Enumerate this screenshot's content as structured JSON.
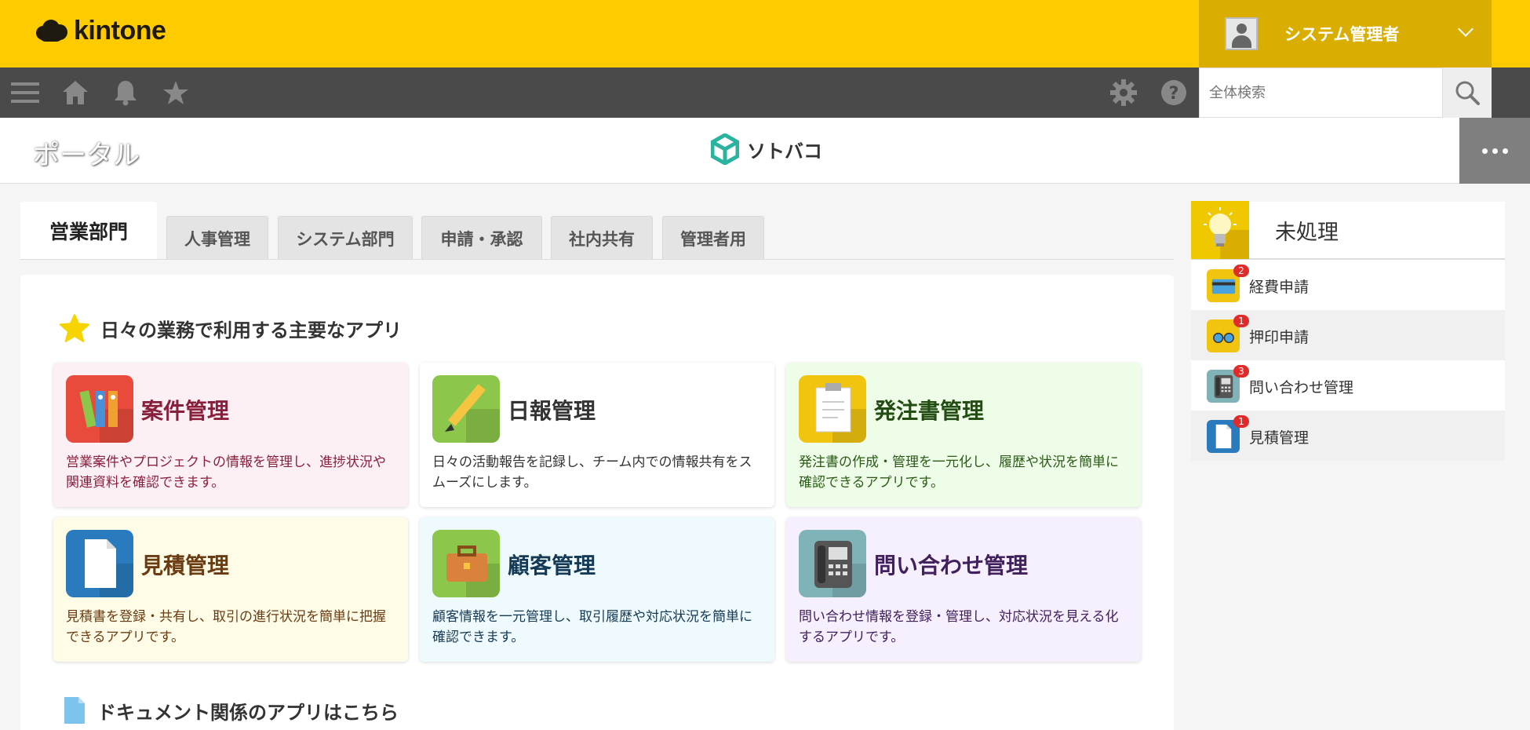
{
  "header": {
    "logo_text": "kintone",
    "user_name": "システム管理者"
  },
  "toolbar": {
    "icons": [
      "menu-icon",
      "home-icon",
      "bell-icon",
      "star-icon",
      "gear-icon",
      "help-icon",
      "search-icon"
    ],
    "search_placeholder": "全体検索"
  },
  "titlebar": {
    "page_title": "ポータル",
    "brand_name": "ソトバコ"
  },
  "tabs": [
    {
      "label": "営業部門",
      "active": true
    },
    {
      "label": "人事管理",
      "active": false
    },
    {
      "label": "システム部門",
      "active": false
    },
    {
      "label": "申請・承認",
      "active": false
    },
    {
      "label": "社内共有",
      "active": false
    },
    {
      "label": "管理者用",
      "active": false
    }
  ],
  "main": {
    "section1_title": "日々の業務で利用する主要なアプリ",
    "section2_title": "ドキュメント関係のアプリはこちら",
    "apps": [
      {
        "title": "案件管理",
        "desc": "営業案件やプロジェクトの情報を管理し、進捗状況や関連資料を確認できます。",
        "bg": "#fdf0f5",
        "title_color": "#8a1f3c",
        "desc_color": "#8a1f3c",
        "icon": "binders-icon",
        "icon_bg": "#e84a3c"
      },
      {
        "title": "日報管理",
        "desc": "日々の活動報告を記録し、チーム内での情報共有をスムーズにします。",
        "bg": "#ffffff",
        "title_color": "#333333",
        "desc_color": "#333333",
        "icon": "pencil-icon",
        "icon_bg": "#8cc64a"
      },
      {
        "title": "発注書管理",
        "desc": "発注書の作成・管理を一元化し、履歴や状況を簡単に確認できるアプリです。",
        "bg": "#eefde8",
        "title_color": "#234d12",
        "desc_color": "#2b5a17",
        "icon": "clipboard-icon",
        "icon_bg": "#f1c40f"
      },
      {
        "title": "見積管理",
        "desc": "見積書を登録・共有し、取引の進行状況を簡単に把握できるアプリです。",
        "bg": "#fefbe6",
        "title_color": "#6b3b12",
        "desc_color": "#6b3b12",
        "icon": "document-icon",
        "icon_bg": "#2a7bbd"
      },
      {
        "title": "顧客管理",
        "desc": "顧客情報を一元管理し、取引履歴や対応状況を簡単に確認できます。",
        "bg": "#eefafd",
        "title_color": "#153a55",
        "desc_color": "#153a55",
        "icon": "briefcase-icon",
        "icon_bg": "#8cc64a"
      },
      {
        "title": "問い合わせ管理",
        "desc": "問い合わせ情報を登録・管理し、対応状況を見える化するアプリです。",
        "bg": "#f6effd",
        "title_color": "#41205e",
        "desc_color": "#41205e",
        "icon": "phone-icon",
        "icon_bg": "#7fb3b8"
      }
    ]
  },
  "sidebar": {
    "title": "未処理",
    "items": [
      {
        "label": "経費申請",
        "badge": "2",
        "icon": "credit-card-icon",
        "icon_bg": "#f1c40f"
      },
      {
        "label": "押印申請",
        "badge": "1",
        "icon": "glasses-icon",
        "icon_bg": "#f1c40f"
      },
      {
        "label": "問い合わせ管理",
        "badge": "3",
        "icon": "phone-icon",
        "icon_bg": "#7fb3b8"
      },
      {
        "label": "見積管理",
        "badge": "1",
        "icon": "document-icon",
        "icon_bg": "#2a7bbd"
      }
    ]
  }
}
